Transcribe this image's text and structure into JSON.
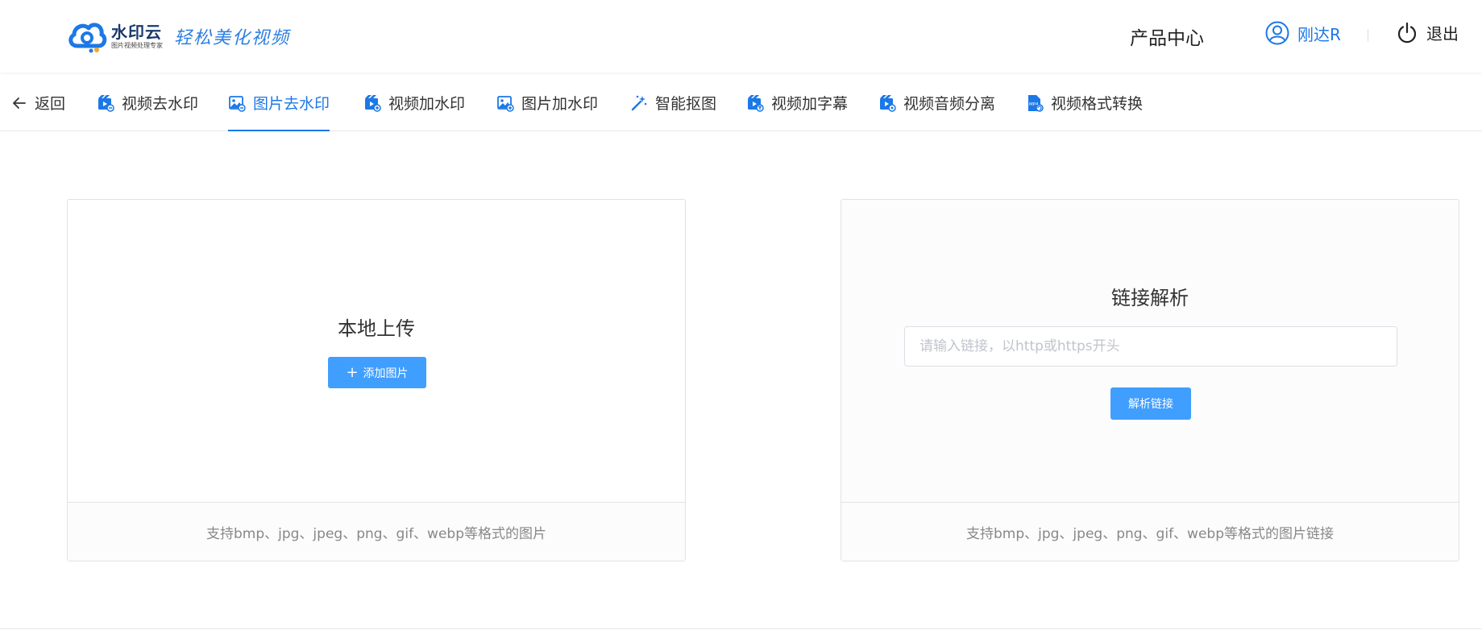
{
  "header": {
    "brand": "水印云",
    "brand_sub": "图片视频处理专家",
    "slogan": "轻松美化视频",
    "product_center": "产品中心",
    "username": "刚达R",
    "logout": "退出"
  },
  "nav": {
    "back": "返回",
    "items": [
      {
        "label": "视频去水印",
        "icon": "video-icon"
      },
      {
        "label": "图片去水印",
        "icon": "image-icon",
        "active": true
      },
      {
        "label": "视频加水印",
        "icon": "video-add-icon"
      },
      {
        "label": "图片加水印",
        "icon": "image-add-icon"
      },
      {
        "label": "智能抠图",
        "icon": "magic-wand-icon"
      },
      {
        "label": "视频加字幕",
        "icon": "video-subtitle-icon"
      },
      {
        "label": "视频音频分离",
        "icon": "video-audio-icon"
      },
      {
        "label": "视频格式转换",
        "icon": "mp4-file-icon"
      }
    ]
  },
  "upload_card": {
    "title": "本地上传",
    "button": "添加图片",
    "footer": "支持bmp、jpg、jpeg、png、gif、webp等格式的图片"
  },
  "link_card": {
    "title": "链接解析",
    "input_value": "",
    "input_placeholder": "请输入链接，以http或https开头",
    "button": "解析链接",
    "footer": "支持bmp、jpg、jpeg、png、gif、webp等格式的图片链接"
  },
  "colors": {
    "accent": "#1c78e6",
    "button": "#409eff",
    "brand_dark": "#1a3a6e"
  }
}
